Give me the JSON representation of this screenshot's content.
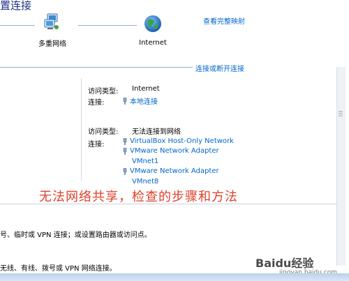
{
  "window": {
    "title": "置连接",
    "top_link": "查看完整映射",
    "divider_link": "连接或断开连接"
  },
  "network_map": {
    "left_node_label": "多重网络",
    "right_node_label": "Internet"
  },
  "networks": [
    {
      "access_type_key": "访问类型:",
      "access_type_value": "Internet",
      "connection_key": "连接:",
      "connections": [
        "本地连接"
      ]
    },
    {
      "access_type_key": "访问类型:",
      "access_type_value": "无法连接到网络",
      "connection_key": "连接:",
      "connections": [
        "VirtualBox Host-Only Network",
        "VMware Network Adapter",
        "VMnet1",
        "VMware Network Adapter",
        "VMnet8"
      ]
    }
  ],
  "overlay_caption": "无法网络共享，检查的步骤和方法",
  "tasks": {
    "line1": "号、临时或 VPN 连接；或设置路由器或访问点。",
    "line2": "无线、有线、拨号或 VPN 网络连接。"
  },
  "watermark": {
    "brand": "Baidu经验",
    "url": "jingyan.baidu.com"
  },
  "colors": {
    "link": "#0066cc",
    "title": "#1e3287",
    "caption": "#e0402a",
    "divider": "#8fb0d8"
  }
}
